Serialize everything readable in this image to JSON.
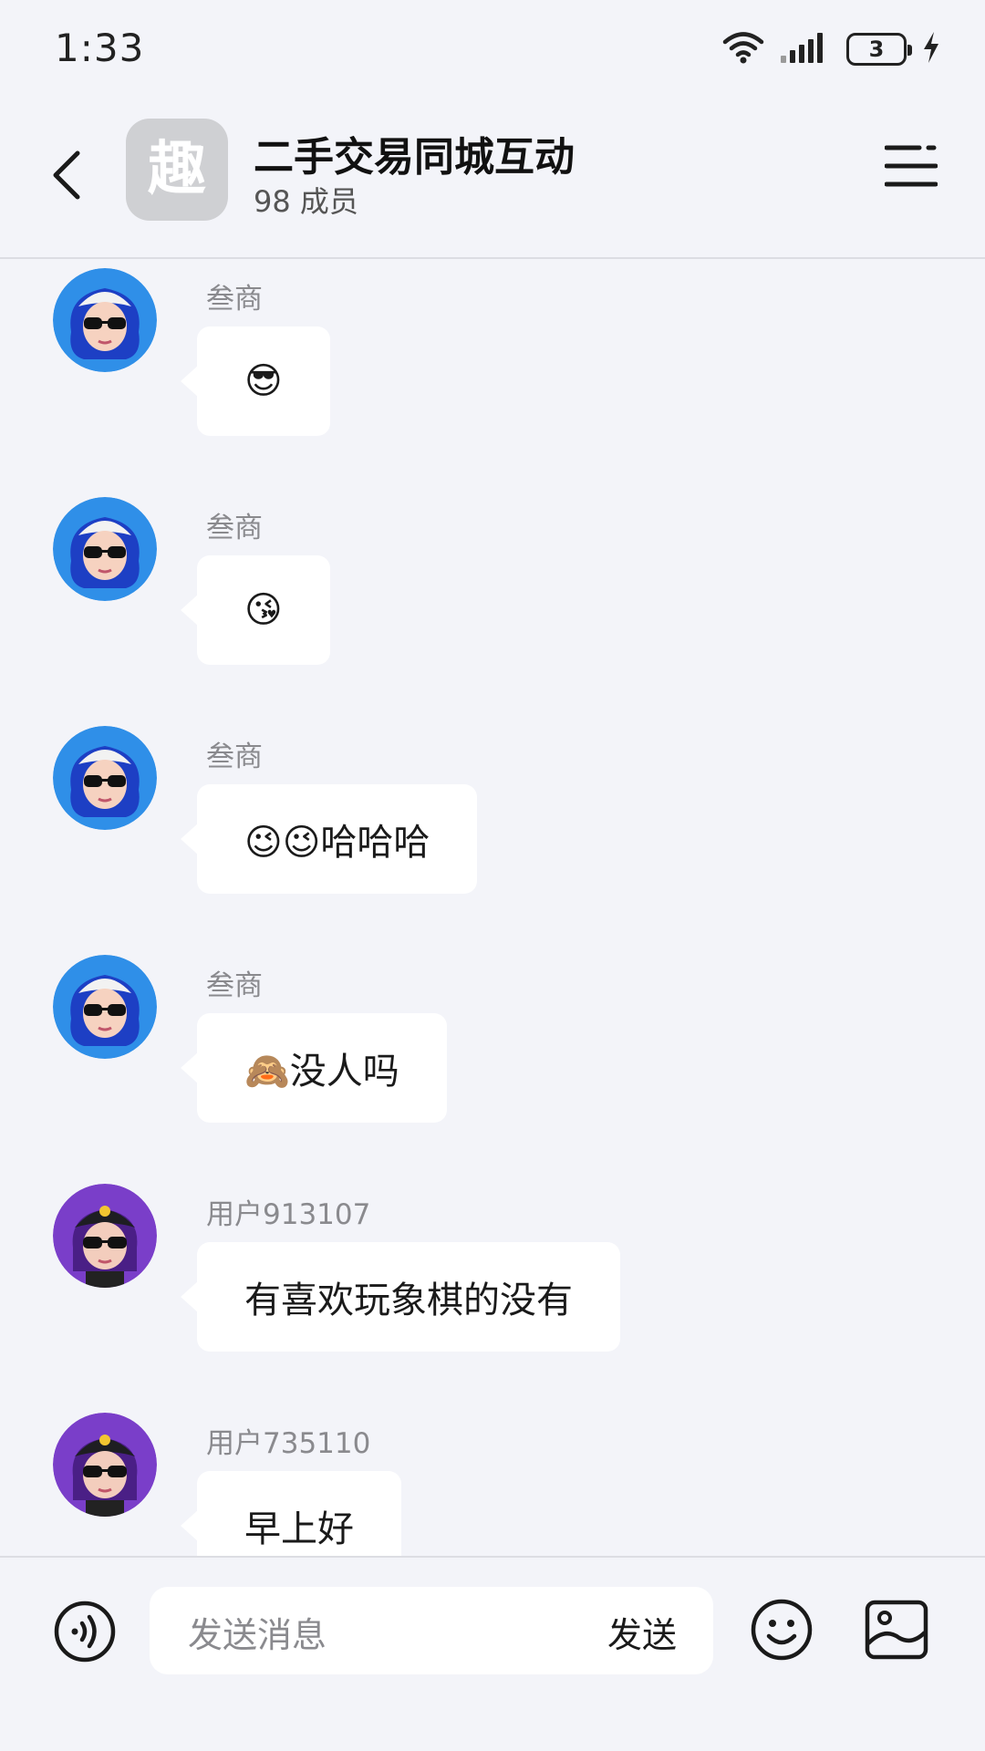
{
  "status_bar": {
    "time": "1:33",
    "battery": "3",
    "icons": [
      "wifi-icon",
      "signal-icon",
      "battery-icon",
      "charging-icon"
    ]
  },
  "header": {
    "back_icon": "chevron-left-icon",
    "group_avatar_glyph": "趣",
    "title": "二手交易同城互动",
    "members": "98 成员",
    "menu_icon": "menu-icon"
  },
  "messages": [
    {
      "sender": "叁商",
      "text": "😎",
      "avatar": "blue-hair-avatar"
    },
    {
      "sender": "叁商",
      "text": "😘",
      "avatar": "blue-hair-avatar"
    },
    {
      "sender": "叁商",
      "text": "😉😉哈哈哈",
      "avatar": "blue-hair-avatar"
    },
    {
      "sender": "叁商",
      "text": "🙈没人吗",
      "avatar": "blue-hair-avatar"
    },
    {
      "sender": "用户913107",
      "text": "有喜欢玩象棋的没有",
      "avatar": "purple-hair-avatar"
    },
    {
      "sender": "用户735110",
      "text": "早上好",
      "avatar": "purple-hair-avatar"
    }
  ],
  "input": {
    "placeholder": "发送消息",
    "send_label": "发送"
  },
  "colors": {
    "background": "#f3f4f9",
    "bubble": "#ffffff",
    "muted_text": "#8a8a8e",
    "blue_avatar": "#2f8fe8",
    "purple_avatar": "#7a3ec9"
  }
}
